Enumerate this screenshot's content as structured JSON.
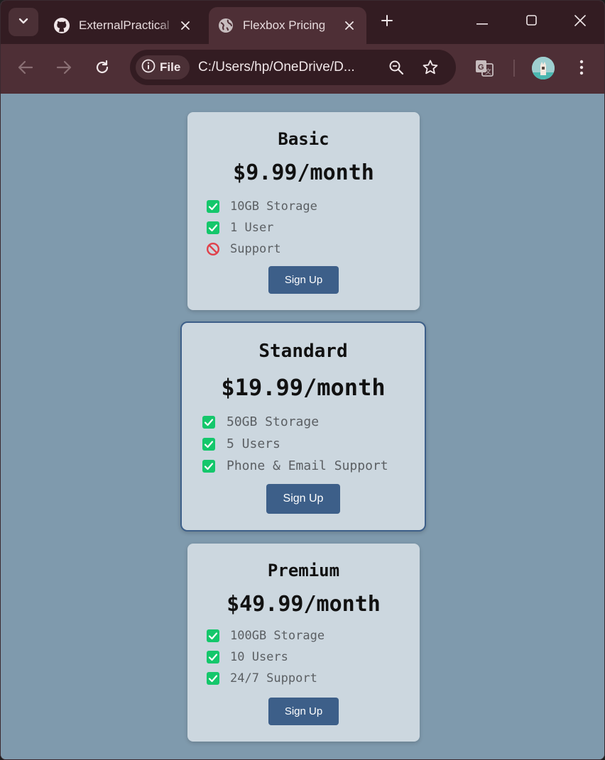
{
  "browser": {
    "tabs": [
      {
        "title": "ExternalPractical",
        "icon": "github-icon",
        "active": false
      },
      {
        "title": "Flexbox Pricing",
        "icon": "globe-icon",
        "active": true
      }
    ],
    "omnibox": {
      "chip_label": "File",
      "url": "C:/Users/hp/OneDrive/D..."
    }
  },
  "plans": [
    {
      "name": "Basic",
      "price": "$9.99/month",
      "features": [
        {
          "text": "10GB Storage",
          "included": true
        },
        {
          "text": "1 User",
          "included": true
        },
        {
          "text": "Support",
          "included": false
        }
      ],
      "button": "Sign Up"
    },
    {
      "name": "Standard",
      "price": "$19.99/month",
      "highlighted": true,
      "features": [
        {
          "text": "50GB Storage",
          "included": true
        },
        {
          "text": "5 Users",
          "included": true
        },
        {
          "text": "Phone & Email Support",
          "included": true
        }
      ],
      "button": "Sign Up"
    },
    {
      "name": "Premium",
      "price": "$49.99/month",
      "features": [
        {
          "text": "100GB Storage",
          "included": true
        },
        {
          "text": "10 Users",
          "included": true
        },
        {
          "text": "24/7 Support",
          "included": true
        }
      ],
      "button": "Sign Up"
    }
  ],
  "colors": {
    "page_bg": "#7f9aad",
    "card_bg": "#ccd7df",
    "button_bg": "#3d5f89",
    "check_green": "#14c76b",
    "no_red": "#e0414b",
    "browser_frame": "#331c22",
    "browser_toolbar": "#4e2f36"
  }
}
